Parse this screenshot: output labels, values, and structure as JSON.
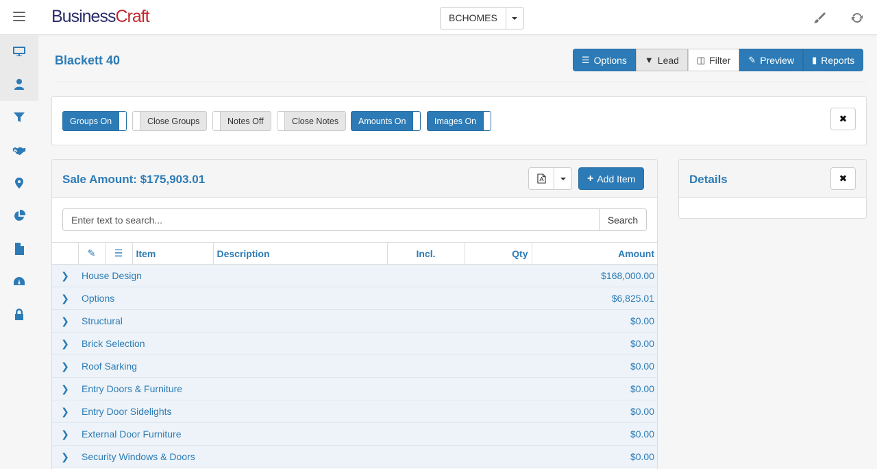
{
  "header": {
    "logo_part1": "Business",
    "logo_part2": "Craft",
    "company": "BCHOMES",
    "brush_icon": "paint-brush-icon",
    "refresh_icon": "refresh-icon"
  },
  "sidebar": {
    "items": [
      {
        "icon": "monitor-icon"
      },
      {
        "icon": "user-icon"
      },
      {
        "icon": "filter-icon"
      },
      {
        "icon": "handshake-icon"
      },
      {
        "icon": "map-marker-icon"
      },
      {
        "icon": "pie-chart-icon"
      },
      {
        "icon": "file-icon"
      },
      {
        "icon": "dashboard-icon"
      },
      {
        "icon": "lock-icon"
      }
    ]
  },
  "page": {
    "title": "Blackett 40"
  },
  "actions": {
    "options": "Options",
    "lead": "Lead",
    "filter": "Filter",
    "preview": "Preview",
    "reports": "Reports"
  },
  "toggles": {
    "groups": "Groups On",
    "close_groups": "Close Groups",
    "notes": "Notes Off",
    "close_notes": "Close Notes",
    "amounts": "Amounts On",
    "images": "Images On"
  },
  "sale": {
    "label": "Sale Amount: $175,903.01",
    "add_item": "Add Item"
  },
  "search": {
    "placeholder": "Enter text to search...",
    "button": "Search"
  },
  "table": {
    "columns": {
      "item": "Item",
      "description": "Description",
      "incl": "Incl.",
      "qty": "Qty",
      "amount": "Amount"
    },
    "rows": [
      {
        "item": "House Design",
        "amount": "$168,000.00"
      },
      {
        "item": "Options",
        "amount": "$6,825.01"
      },
      {
        "item": "Structural",
        "amount": "$0.00"
      },
      {
        "item": "Brick Selection",
        "amount": "$0.00"
      },
      {
        "item": "Roof Sarking",
        "amount": "$0.00"
      },
      {
        "item": "Entry Doors & Furniture",
        "amount": "$0.00"
      },
      {
        "item": "Entry Door Sidelights",
        "amount": "$0.00"
      },
      {
        "item": "External Door Furniture",
        "amount": "$0.00"
      },
      {
        "item": "Security Windows & Doors",
        "amount": "$0.00"
      }
    ]
  },
  "details": {
    "title": "Details"
  }
}
